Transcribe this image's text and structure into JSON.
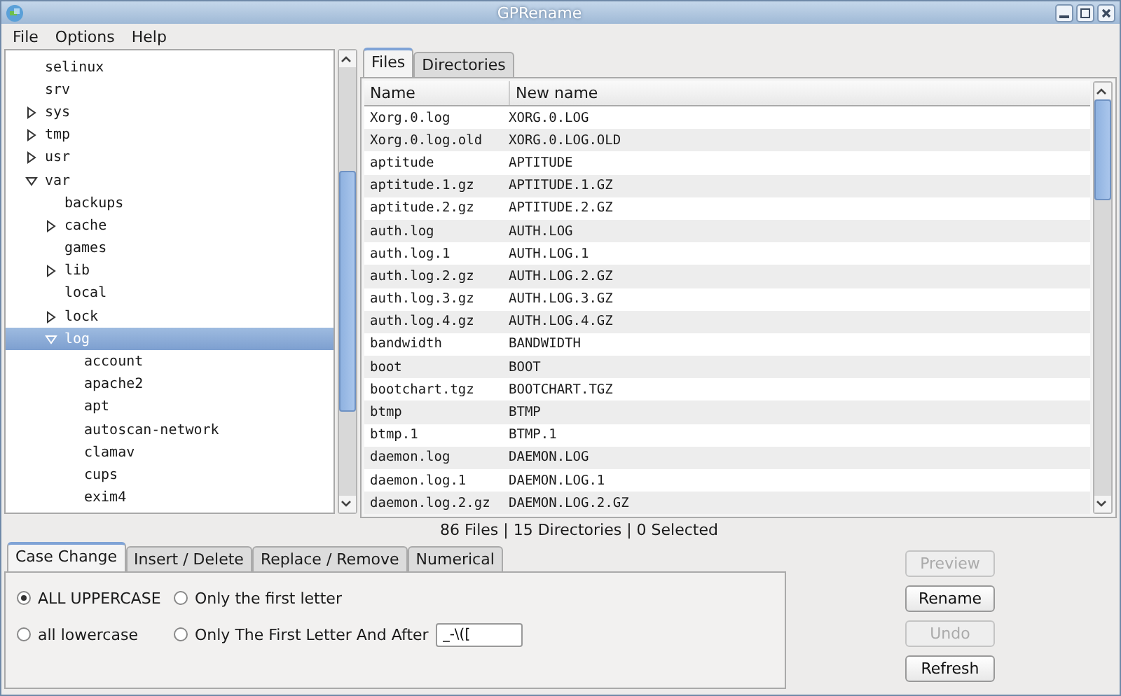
{
  "window": {
    "title": "GPRename"
  },
  "menu": [
    "File",
    "Options",
    "Help"
  ],
  "tree": [
    {
      "label": "selinux",
      "selected": false
    },
    {
      "label": "srv",
      "selected": false
    },
    {
      "label": "sys",
      "expanded": false,
      "selected": false
    },
    {
      "label": "tmp",
      "expanded": false,
      "selected": false
    },
    {
      "label": "usr",
      "expanded": false,
      "selected": false
    },
    {
      "label": "var",
      "expanded": true,
      "selected": false,
      "children": [
        {
          "label": "backups",
          "selected": false
        },
        {
          "label": "cache",
          "expanded": false,
          "selected": false
        },
        {
          "label": "games",
          "selected": false
        },
        {
          "label": "lib",
          "expanded": false,
          "selected": false
        },
        {
          "label": "local",
          "selected": false
        },
        {
          "label": "lock",
          "expanded": false,
          "selected": false
        },
        {
          "label": "log",
          "expanded": true,
          "selected": true,
          "children": [
            {
              "label": "account",
              "selected": false
            },
            {
              "label": "apache2",
              "selected": false
            },
            {
              "label": "apt",
              "selected": false
            },
            {
              "label": "autoscan-network",
              "selected": false
            },
            {
              "label": "clamav",
              "selected": false
            },
            {
              "label": "cups",
              "selected": false
            },
            {
              "label": "exim4",
              "selected": false
            }
          ]
        }
      ]
    }
  ],
  "file_tabs": [
    {
      "label": "Files",
      "selected": true
    },
    {
      "label": "Directories",
      "selected": false
    }
  ],
  "table": {
    "columns": [
      "Name",
      "New name"
    ],
    "rows": [
      [
        "Xorg.0.log",
        "XORG.0.LOG"
      ],
      [
        "Xorg.0.log.old",
        "XORG.0.LOG.OLD"
      ],
      [
        "aptitude",
        "APTITUDE"
      ],
      [
        "aptitude.1.gz",
        "APTITUDE.1.GZ"
      ],
      [
        "aptitude.2.gz",
        "APTITUDE.2.GZ"
      ],
      [
        "auth.log",
        "AUTH.LOG"
      ],
      [
        "auth.log.1",
        "AUTH.LOG.1"
      ],
      [
        "auth.log.2.gz",
        "AUTH.LOG.2.GZ"
      ],
      [
        "auth.log.3.gz",
        "AUTH.LOG.3.GZ"
      ],
      [
        "auth.log.4.gz",
        "AUTH.LOG.4.GZ"
      ],
      [
        "bandwidth",
        "BANDWIDTH"
      ],
      [
        "boot",
        "BOOT"
      ],
      [
        "bootchart.tgz",
        "BOOTCHART.TGZ"
      ],
      [
        "btmp",
        "BTMP"
      ],
      [
        "btmp.1",
        "BTMP.1"
      ],
      [
        "daemon.log",
        "DAEMON.LOG"
      ],
      [
        "daemon.log.1",
        "DAEMON.LOG.1"
      ],
      [
        "daemon.log.2.gz",
        "DAEMON.LOG.2.GZ"
      ]
    ]
  },
  "status_bar": "86 Files | 15 Directories | 0 Selected",
  "option_tabs": [
    {
      "label": "Case Change",
      "selected": true
    },
    {
      "label": "Insert / Delete",
      "selected": false
    },
    {
      "label": "Replace / Remove",
      "selected": false
    },
    {
      "label": "Numerical",
      "selected": false
    }
  ],
  "case_options": [
    {
      "label": "ALL UPPERCASE",
      "selected": true
    },
    {
      "label": "Only the first letter",
      "selected": false
    },
    {
      "label": "all lowercase",
      "selected": false
    },
    {
      "label": "Only The First Letter And After",
      "selected": false
    }
  ],
  "after_chars": {
    "value": "_-\\(["
  },
  "buttons": [
    {
      "label": "Preview",
      "disabled": true
    },
    {
      "label": "Rename",
      "disabled": false
    },
    {
      "label": "Undo",
      "disabled": true
    },
    {
      "label": "Refresh",
      "disabled": false
    }
  ]
}
